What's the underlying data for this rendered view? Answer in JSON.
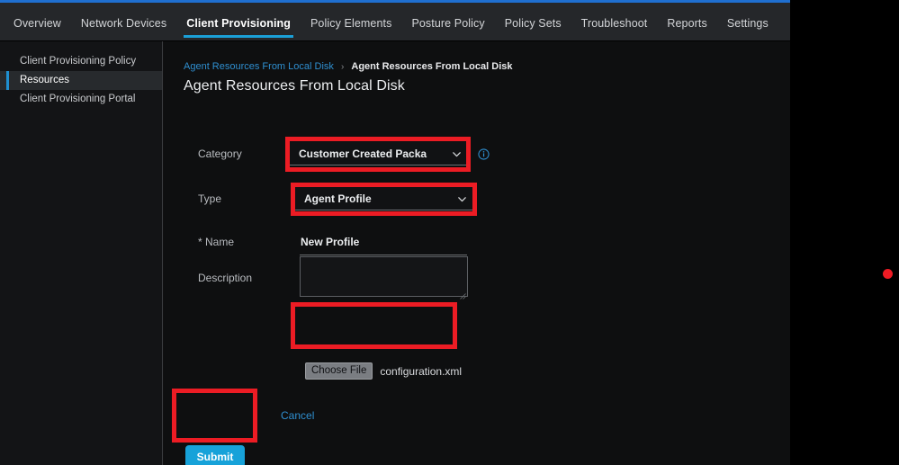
{
  "window": {
    "accent_blue": "#1ba0d7",
    "top_border_color": "#1f6fd0",
    "highlight_color": "#ec1c24",
    "background": "#101011"
  },
  "top_nav": {
    "items": [
      {
        "label": "Overview",
        "active": false
      },
      {
        "label": "Network Devices",
        "active": false
      },
      {
        "label": "Client Provisioning",
        "active": true
      },
      {
        "label": "Policy Elements",
        "active": false
      },
      {
        "label": "Posture Policy",
        "active": false
      },
      {
        "label": "Policy Sets",
        "active": false
      },
      {
        "label": "Troubleshoot",
        "active": false
      },
      {
        "label": "Reports",
        "active": false
      },
      {
        "label": "Settings",
        "active": false
      }
    ]
  },
  "sidebar": {
    "items": [
      {
        "label": "Client Provisioning Policy",
        "active": false
      },
      {
        "label": "Resources",
        "active": true
      },
      {
        "label": "Client Provisioning Portal",
        "active": false
      }
    ]
  },
  "breadcrumb": {
    "parent": "Agent Resources From Local Disk",
    "separator": "›",
    "current": "Agent Resources From Local Disk"
  },
  "page": {
    "title": "Agent Resources From Local Disk"
  },
  "form": {
    "category": {
      "label": "Category",
      "value": "Customer Created Packa",
      "icon": "chevron-down-icon",
      "info_icon": "info-icon"
    },
    "type": {
      "label": "Type",
      "value": "Agent Profile",
      "icon": "chevron-down-icon"
    },
    "name": {
      "label": "* Name",
      "value": "New Profile"
    },
    "description": {
      "label": "Description",
      "value": "",
      "placeholder": ""
    },
    "file": {
      "button_label": "Choose File",
      "file_name": "configuration.xml"
    }
  },
  "actions": {
    "submit_label": "Submit",
    "cancel_label": "Cancel"
  }
}
